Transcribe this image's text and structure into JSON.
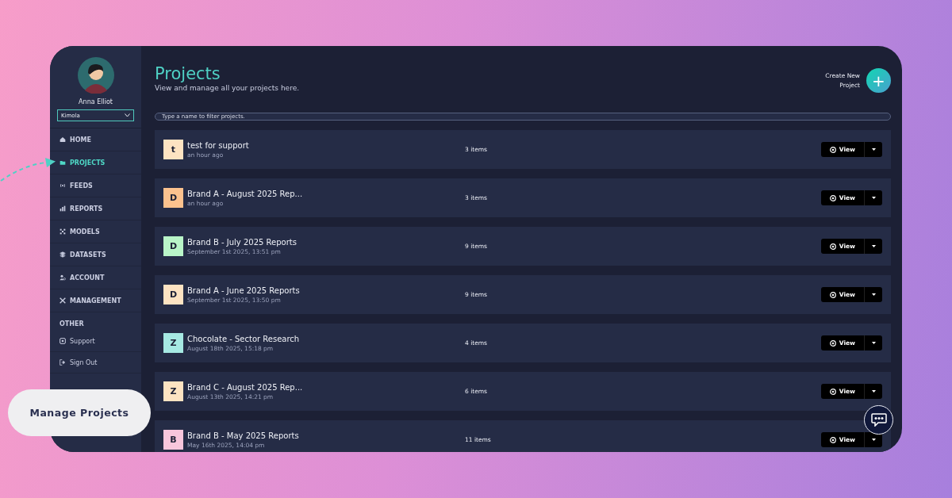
{
  "callout": {
    "label": "Manage Projects"
  },
  "sidebar": {
    "user": {
      "name": "Anna Elliot"
    },
    "workspace": {
      "value": "Kimola"
    },
    "items": [
      {
        "label": "HOME",
        "kind": "home",
        "selected": false
      },
      {
        "label": "PROJECTS",
        "kind": "folder",
        "selected": true
      },
      {
        "label": "FEEDS",
        "kind": "feed",
        "selected": false
      },
      {
        "label": "REPORTS",
        "kind": "chart",
        "selected": false
      },
      {
        "label": "MODELS",
        "kind": "model",
        "selected": false
      },
      {
        "label": "DATASETS",
        "kind": "layers",
        "selected": false
      },
      {
        "label": "ACCOUNT",
        "kind": "user",
        "selected": false
      },
      {
        "label": "MANAGEMENT",
        "kind": "tools",
        "selected": false
      }
    ],
    "other_heading": "OTHER",
    "other_items": [
      {
        "label": "Support",
        "kind": "support"
      },
      {
        "label": "Sign Out",
        "kind": "signout"
      }
    ]
  },
  "header": {
    "title": "Projects",
    "subtitle": "View and manage all your projects here.",
    "create_label": "Create New Project",
    "create_icon": "+"
  },
  "filter": {
    "placeholder": "Type a name to filter projects."
  },
  "projects": [
    {
      "initial": "t",
      "color": "#fde3c2",
      "name": "test for support",
      "date": "an hour ago",
      "count": "3 items",
      "action": "View"
    },
    {
      "initial": "D",
      "color": "#fcc28e",
      "name": "Brand A - August 2025 Rep...",
      "date": "an hour ago",
      "count": "3 items",
      "action": "View"
    },
    {
      "initial": "D",
      "color": "#b9f5c8",
      "name": "Brand B - July 2025 Reports",
      "date": "September 1st 2025, 13:51 pm",
      "count": "9 items",
      "action": "View"
    },
    {
      "initial": "D",
      "color": "#fde3c2",
      "name": "Brand A - June 2025 Reports",
      "date": "September 1st 2025, 13:50 pm",
      "count": "9 items",
      "action": "View"
    },
    {
      "initial": "Z",
      "color": "#a6e9e3",
      "name": "Chocolate - Sector Research",
      "date": "August 18th 2025, 15:18 pm",
      "count": "4 items",
      "action": "View"
    },
    {
      "initial": "Z",
      "color": "#fde3c2",
      "name": "Brand C - August 2025 Rep...",
      "date": "August 13th 2025, 14:21 pm",
      "count": "6 items",
      "action": "View"
    },
    {
      "initial": "B",
      "color": "#f8c6dc",
      "name": "Brand B - May 2025 Reports",
      "date": "May 16th 2025, 14:04 pm",
      "count": "11 items",
      "action": "View"
    }
  ]
}
